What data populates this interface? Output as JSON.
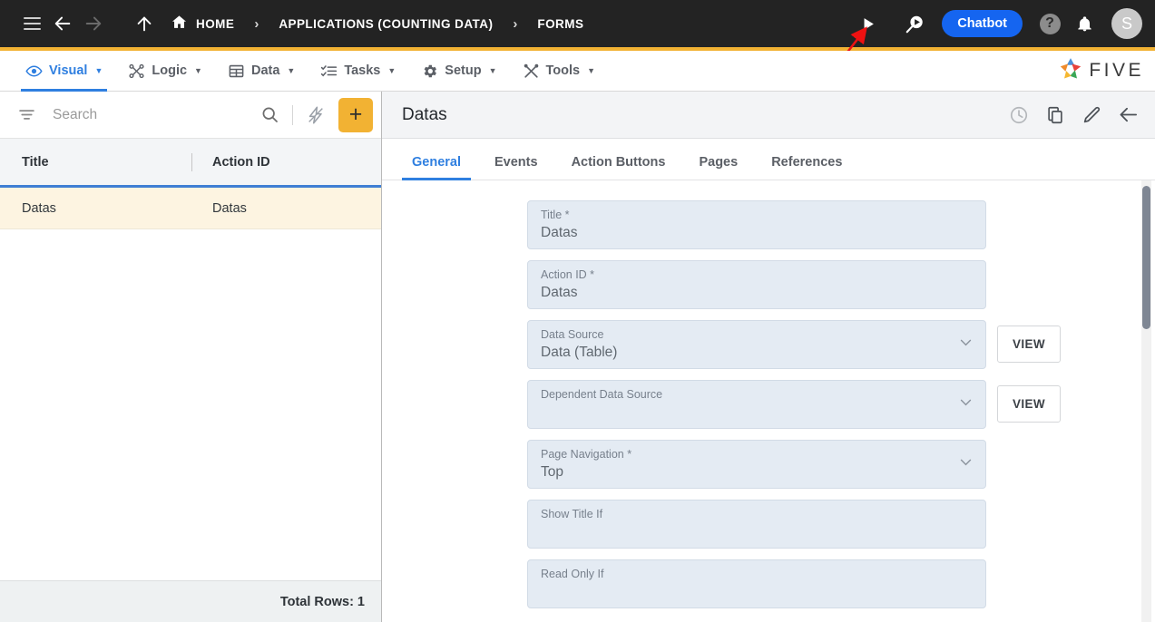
{
  "topbar": {
    "menu_icon": "hamburger-icon",
    "back_icon": "arrow-left-icon",
    "forward_icon": "arrow-right-icon",
    "up_icon": "arrow-up-icon",
    "breadcrumbs": [
      {
        "label": "HOME",
        "icon": "home-icon"
      },
      {
        "label": "APPLICATIONS (COUNTING DATA)",
        "icon": ""
      },
      {
        "label": "FORMS",
        "icon": ""
      }
    ],
    "separator": "›",
    "run_icon": "play-icon",
    "search_run_icon": "search-play-icon",
    "chatbot_label": "Chatbot",
    "help_label": "?",
    "bell_icon": "bell-icon",
    "avatar_initial": "S",
    "accent_color": "#f2b233",
    "chatbot_color": "#1565f0"
  },
  "menubar": {
    "items": [
      {
        "label": "Visual",
        "icon": "eye-icon",
        "caret": "▼",
        "active": true
      },
      {
        "label": "Logic",
        "icon": "logic-nodes-icon",
        "caret": "▼",
        "active": false
      },
      {
        "label": "Data",
        "icon": "table-grid-icon",
        "caret": "▼",
        "active": false
      },
      {
        "label": "Tasks",
        "icon": "checklist-icon",
        "caret": "▼",
        "active": false
      },
      {
        "label": "Setup",
        "icon": "gear-icon",
        "caret": "▼",
        "active": false
      },
      {
        "label": "Tools",
        "icon": "tools-icon",
        "caret": "▼",
        "active": false
      }
    ],
    "brand": "FIVE",
    "active_color": "#2f7fe0"
  },
  "sidebar": {
    "search": {
      "placeholder": "Search",
      "value": ""
    },
    "filter_icon": "filter-icon",
    "search_icon": "search-icon",
    "lightning_icon": "lightning-disabled-icon",
    "add_label": "+",
    "columns": [
      "Title",
      "Action ID"
    ],
    "rows": [
      {
        "title": "Datas",
        "action_id": "Datas"
      }
    ],
    "footer": "Total Rows: 1"
  },
  "detail": {
    "title": "Datas",
    "actions": [
      {
        "name": "history-icon",
        "faded": true
      },
      {
        "name": "copy-icon",
        "faded": false
      },
      {
        "name": "edit-pencil-icon",
        "faded": false
      },
      {
        "name": "back-arrow-icon",
        "faded": false
      }
    ],
    "tabs": [
      {
        "label": "General",
        "active": true
      },
      {
        "label": "Events",
        "active": false
      },
      {
        "label": "Action Buttons",
        "active": false
      },
      {
        "label": "Pages",
        "active": false
      },
      {
        "label": "References",
        "active": false
      }
    ],
    "fields": [
      {
        "label": "Title *",
        "value": "Datas",
        "type": "text",
        "view_button": ""
      },
      {
        "label": "Action ID *",
        "value": "Datas",
        "type": "text",
        "view_button": ""
      },
      {
        "label": "Data Source",
        "value": "Data (Table)",
        "type": "select",
        "view_button": "VIEW"
      },
      {
        "label": "Dependent Data Source",
        "value": "",
        "type": "select",
        "view_button": "VIEW"
      },
      {
        "label": "Page Navigation *",
        "value": "Top",
        "type": "select",
        "view_button": ""
      },
      {
        "label": "Show Title If",
        "value": "",
        "type": "text",
        "view_button": ""
      },
      {
        "label": "Read Only If",
        "value": "",
        "type": "text",
        "view_button": ""
      }
    ]
  },
  "annotation": {
    "arrow_color": "#ee1111",
    "points_to": "play-icon"
  }
}
